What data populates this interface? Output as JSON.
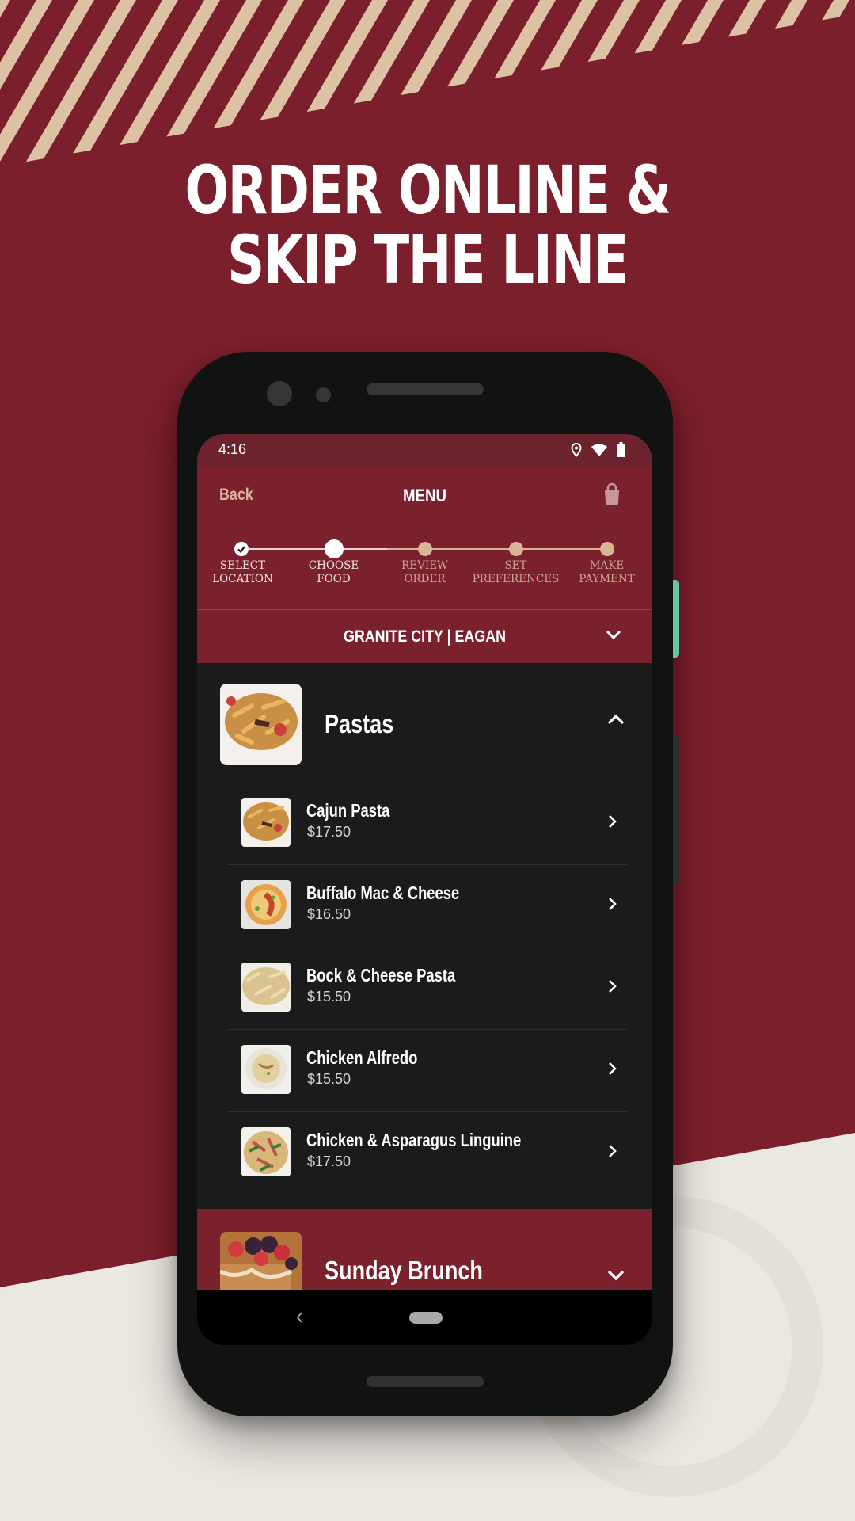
{
  "colors": {
    "brand_red": "#7b202d",
    "background_red": "#7c1f2c",
    "stripe_tan": "#dcc1a3",
    "cream": "#ebe7e1",
    "dark_surface": "#1b1b1b",
    "accent_tan": "#d8b595"
  },
  "promo": {
    "headline_line1": "ORDER ONLINE &",
    "headline_line2": "SKIP THE LINE"
  },
  "status_bar": {
    "time": "4:16",
    "icons": [
      "location-icon",
      "wifi-icon",
      "battery-icon"
    ]
  },
  "app_bar": {
    "back_label": "Back",
    "title": "MENU",
    "cart_icon": "shopping-bag-icon"
  },
  "stepper": {
    "current_step": 2,
    "steps": [
      {
        "line1": "SELECT",
        "line2": "LOCATION",
        "state": "completed"
      },
      {
        "line1": "CHOOSE",
        "line2": "FOOD",
        "state": "current"
      },
      {
        "line1": "REVIEW",
        "line2": "ORDER",
        "state": "upcoming"
      },
      {
        "line1": "SET",
        "line2": "PREFERENCES",
        "state": "upcoming"
      },
      {
        "line1": "MAKE",
        "line2": "PAYMENT",
        "state": "upcoming"
      }
    ]
  },
  "location": {
    "label": "GRANITE CITY | EAGAN",
    "icon": "chevron-down-icon"
  },
  "categories": [
    {
      "title": "Pastas",
      "expanded": true,
      "items": [
        {
          "name": "Cajun Pasta",
          "price": "$17.50"
        },
        {
          "name": "Buffalo Mac & Cheese",
          "price": "$16.50"
        },
        {
          "name": "Bock & Cheese Pasta",
          "price": "$15.50"
        },
        {
          "name": "Chicken Alfredo",
          "price": "$15.50"
        },
        {
          "name": "Chicken & Asparagus Linguine",
          "price": "$17.50"
        }
      ]
    },
    {
      "title": "Sunday Brunch",
      "expanded": false,
      "items": []
    }
  ],
  "nav_bar": {
    "back_icon": "nav-back-icon",
    "home_icon": "nav-home-pill"
  }
}
